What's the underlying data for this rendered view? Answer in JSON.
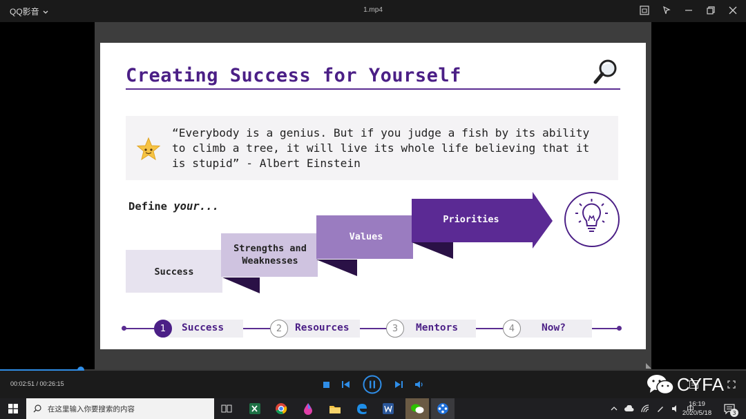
{
  "titlebar": {
    "app_name": "QQ影音",
    "file_name": "1.mp4"
  },
  "slide": {
    "title": "Creating Success for Yourself",
    "quote": "“Everybody is a genius. But if you judge a fish by its ability to climb a tree, it will live its whole life believing that it is stupid” - Albert Einstein",
    "define_prefix": "Define ",
    "define_emphasis": "your...",
    "steps": [
      {
        "label_line1": "Success",
        "label_line2": ""
      },
      {
        "label_line1": "Strengths and",
        "label_line2": "Weaknesses"
      },
      {
        "label_line1": "Values",
        "label_line2": ""
      },
      {
        "label_line1": "Priorities",
        "label_line2": ""
      }
    ],
    "progress": [
      {
        "number": "1",
        "label": "Success",
        "active": true
      },
      {
        "number": "2",
        "label": "Resources",
        "active": false
      },
      {
        "number": "3",
        "label": "Mentors",
        "active": false
      },
      {
        "number": "4",
        "label": "Now?",
        "active": false
      }
    ],
    "colors": {
      "accent": "#4b1f86",
      "step1": "#e7e3ef",
      "step2": "#cfc3e0",
      "step3": "#9a7cc0",
      "step4": "#5b2a94",
      "shadow": "#2a1146"
    }
  },
  "player": {
    "time": "00:02:51 / 00:26:15",
    "progress_fraction": 0.108,
    "watermark": "CYFA",
    "icons": [
      "stop-icon",
      "previous-icon",
      "pause-icon",
      "next-icon",
      "volume-icon",
      "wechat-icon"
    ]
  },
  "taskbar": {
    "search_placeholder": "在这里输入你要搜索的内容",
    "ime": "中",
    "time": "16:19",
    "date": "2020/5/18",
    "notifications": "3"
  }
}
